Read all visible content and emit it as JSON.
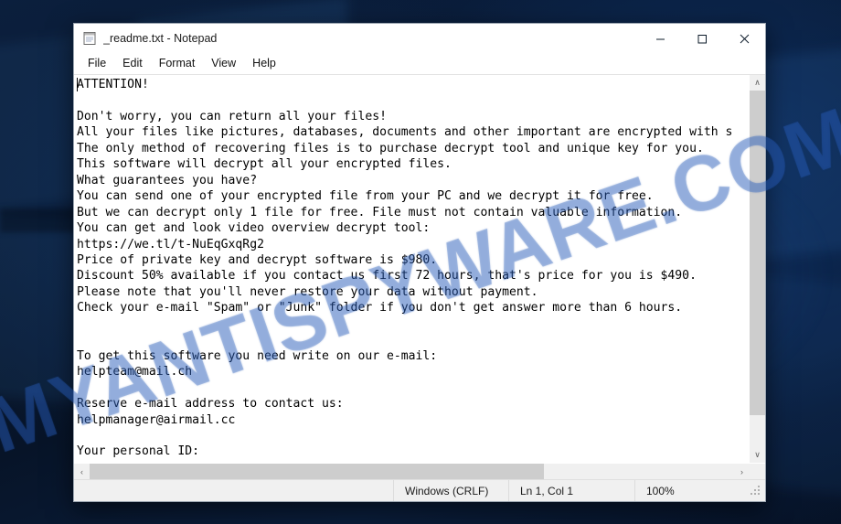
{
  "desktop": {
    "watermark": "MYANTISPYWARE.COM",
    "wallpaper_color": "#0a1b34",
    "watermark_color": "#2c60be"
  },
  "window": {
    "title": "_readme.txt - Notepad",
    "icon": "notepad-icon",
    "controls": {
      "minimize": "–",
      "maximize": "□",
      "close": "✕"
    }
  },
  "menu": {
    "items": [
      {
        "label": "File"
      },
      {
        "label": "Edit"
      },
      {
        "label": "Format"
      },
      {
        "label": "View"
      },
      {
        "label": "Help"
      }
    ]
  },
  "editor": {
    "text": "ATTENTION!\n\nDon't worry, you can return all your files!\nAll your files like pictures, databases, documents and other important are encrypted with s\nThe only method of recovering files is to purchase decrypt tool and unique key for you.\nThis software will decrypt all your encrypted files.\nWhat guarantees you have?\nYou can send one of your encrypted file from your PC and we decrypt it for free.\nBut we can decrypt only 1 file for free. File must not contain valuable information.\nYou can get and look video overview decrypt tool:\nhttps://we.tl/t-NuEqGxqRg2\nPrice of private key and decrypt software is $980.\nDiscount 50% available if you contact us first 72 hours, that's price for you is $490.\nPlease note that you'll never restore your data without payment.\nCheck your e-mail \"Spam\" or \"Junk\" folder if you don't get answer more than 6 hours.\n\n\nTo get this software you need write on our e-mail:\nhelpteam@mail.ch\n\nReserve e-mail address to contact us:\nhelpmanager@airmail.cc\n\nYour personal ID:",
    "ransom_note": {
      "heading": "ATTENTION!",
      "price_full": "$980",
      "price_discounted": "$490",
      "discount_percent": "50%",
      "discount_window_hours": "72",
      "response_time_hours": "6",
      "video_url": "https://we.tl/t-NuEqGxqRg2",
      "email_primary": "helpteam@mail.ch",
      "email_reserve": "helpmanager@airmail.cc",
      "free_decrypt_files": "1"
    }
  },
  "scrollbars": {
    "vertical": {
      "up_arrow": "∧",
      "down_arrow": "∨",
      "thumb_position_percent": 0,
      "thumb_size_percent": 91
    },
    "horizontal": {
      "left_arrow": "‹",
      "right_arrow": "›",
      "thumb_position_percent": 0,
      "thumb_size_percent": 70
    }
  },
  "status_bar": {
    "line_ending": "Windows (CRLF)",
    "cursor_position": "Ln 1, Col 1",
    "zoom": "100%"
  }
}
